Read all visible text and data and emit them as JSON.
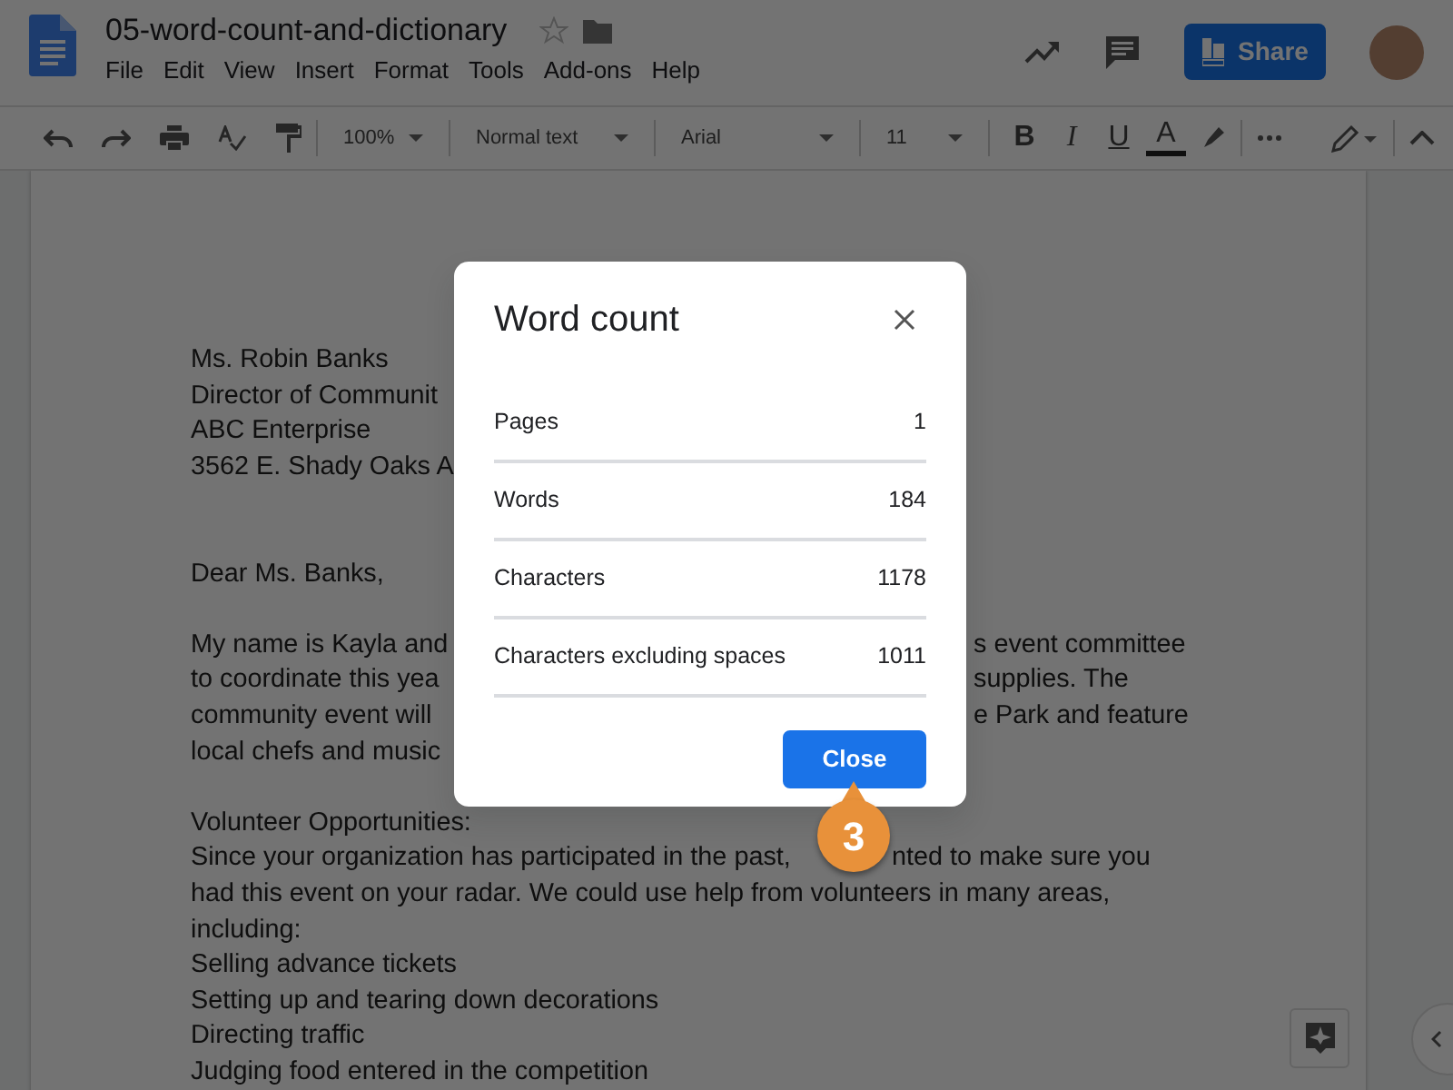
{
  "window": {
    "title": "05-word-count-and-dictionary"
  },
  "menu": [
    "File",
    "Edit",
    "View",
    "Insert",
    "Format",
    "Tools",
    "Add-ons",
    "Help"
  ],
  "header": {
    "share_button": "Share"
  },
  "toolbar": {
    "zoom": "100%",
    "style": "Normal text",
    "font": "Arial",
    "size": "11",
    "format_buttons": [
      {
        "label": "B",
        "kind": "bold"
      },
      {
        "label": "I",
        "kind": "italic"
      },
      {
        "label": "U",
        "kind": "underline"
      },
      {
        "label": "A",
        "kind": "text-color"
      }
    ]
  },
  "document": {
    "lines": [
      {
        "kind": "text",
        "left": "Ms. Robin Banks"
      },
      {
        "kind": "text",
        "left": "Director of Communit"
      },
      {
        "kind": "text",
        "left": "ABC Enterprise"
      },
      {
        "kind": "text",
        "left": "3562 E. Shady Oaks A"
      },
      {
        "kind": "blank"
      },
      {
        "kind": "blank"
      },
      {
        "kind": "text",
        "left": "Dear Ms. Banks,"
      },
      {
        "kind": "blank"
      },
      {
        "kind": "under-dialog",
        "left": "My name is Kayla and",
        "right": "s event committee"
      },
      {
        "kind": "under-dialog",
        "left": "to coordinate this yea",
        "right": "supplies. The"
      },
      {
        "kind": "under-dialog",
        "left": "community event will",
        "right": "e Park and feature"
      },
      {
        "kind": "under-dialog",
        "left": "local chefs and music"
      },
      {
        "kind": "blank"
      },
      {
        "kind": "text",
        "left": "Volunteer Opportunities:"
      },
      {
        "kind": "under-marker",
        "left": "Since your organization has participated in the past,",
        "right": "nted to make sure you"
      },
      {
        "kind": "text",
        "left": "had this event on your radar. We could use help from volunteers in many areas,"
      },
      {
        "kind": "text",
        "left": "including:"
      },
      {
        "kind": "text",
        "left": "Selling advance tickets"
      },
      {
        "kind": "text",
        "left": "Setting up and tearing down decorations"
      },
      {
        "kind": "text",
        "left": "Directing traffic"
      },
      {
        "kind": "text",
        "left": "Judging food entered in the competition"
      }
    ]
  },
  "dialog": {
    "title": "Word count",
    "stats": [
      {
        "label": "Pages",
        "value": "1"
      },
      {
        "label": "Words",
        "value": "184"
      },
      {
        "label": "Characters",
        "value": "1178"
      },
      {
        "label": "Characters excluding spaces",
        "value": "1011"
      }
    ],
    "close_button": "Close"
  },
  "callout": {
    "number": "3"
  }
}
